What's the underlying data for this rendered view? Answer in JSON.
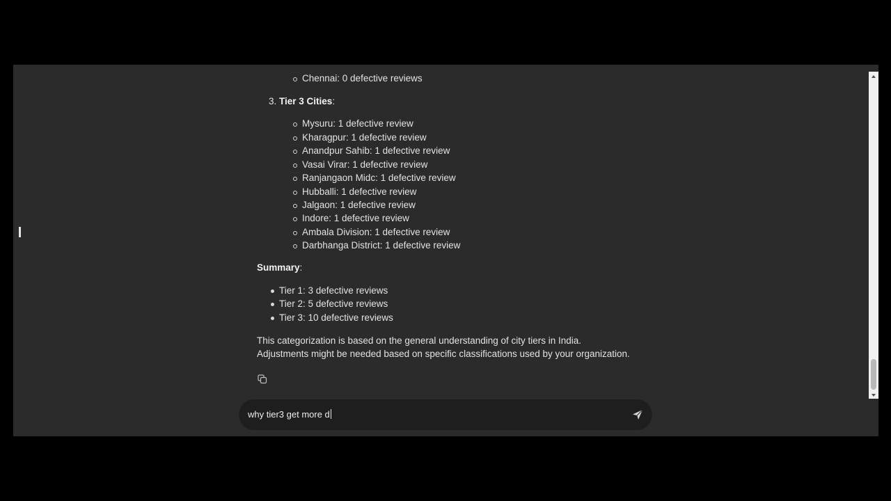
{
  "message": {
    "prev_item": "Chennai: 0 defective reviews",
    "tier3_number": "3.",
    "tier3_heading": "Tier 3 Cities",
    "tier3_colon": ":",
    "tier3_items": [
      "Mysuru: 1 defective review",
      "Kharagpur: 1 defective review",
      "Anandpur Sahib: 1 defective review",
      "Vasai Virar: 1 defective review",
      "Ranjangaon Midc: 1 defective review",
      "Hubballi: 1 defective review",
      "Jalgaon: 1 defective review",
      "Indore: 1 defective review",
      "Ambala Division: 1 defective review",
      "Darbhanga District: 1 defective review"
    ],
    "summary_heading": "Summary",
    "summary_colon": ":",
    "summary_items": [
      "Tier 1: 3 defective reviews",
      "Tier 2: 5 defective reviews",
      "Tier 3: 10 defective reviews"
    ],
    "conclusion_line1": "This categorization is based on the general understanding of city tiers in India.",
    "conclusion_line2": "Adjustments might be needed based on specific classifications used by your organization."
  },
  "actions": {
    "copy_icon": "copy-icon"
  },
  "composer": {
    "value": "why tier3 get more d",
    "send_icon": "send-icon"
  }
}
